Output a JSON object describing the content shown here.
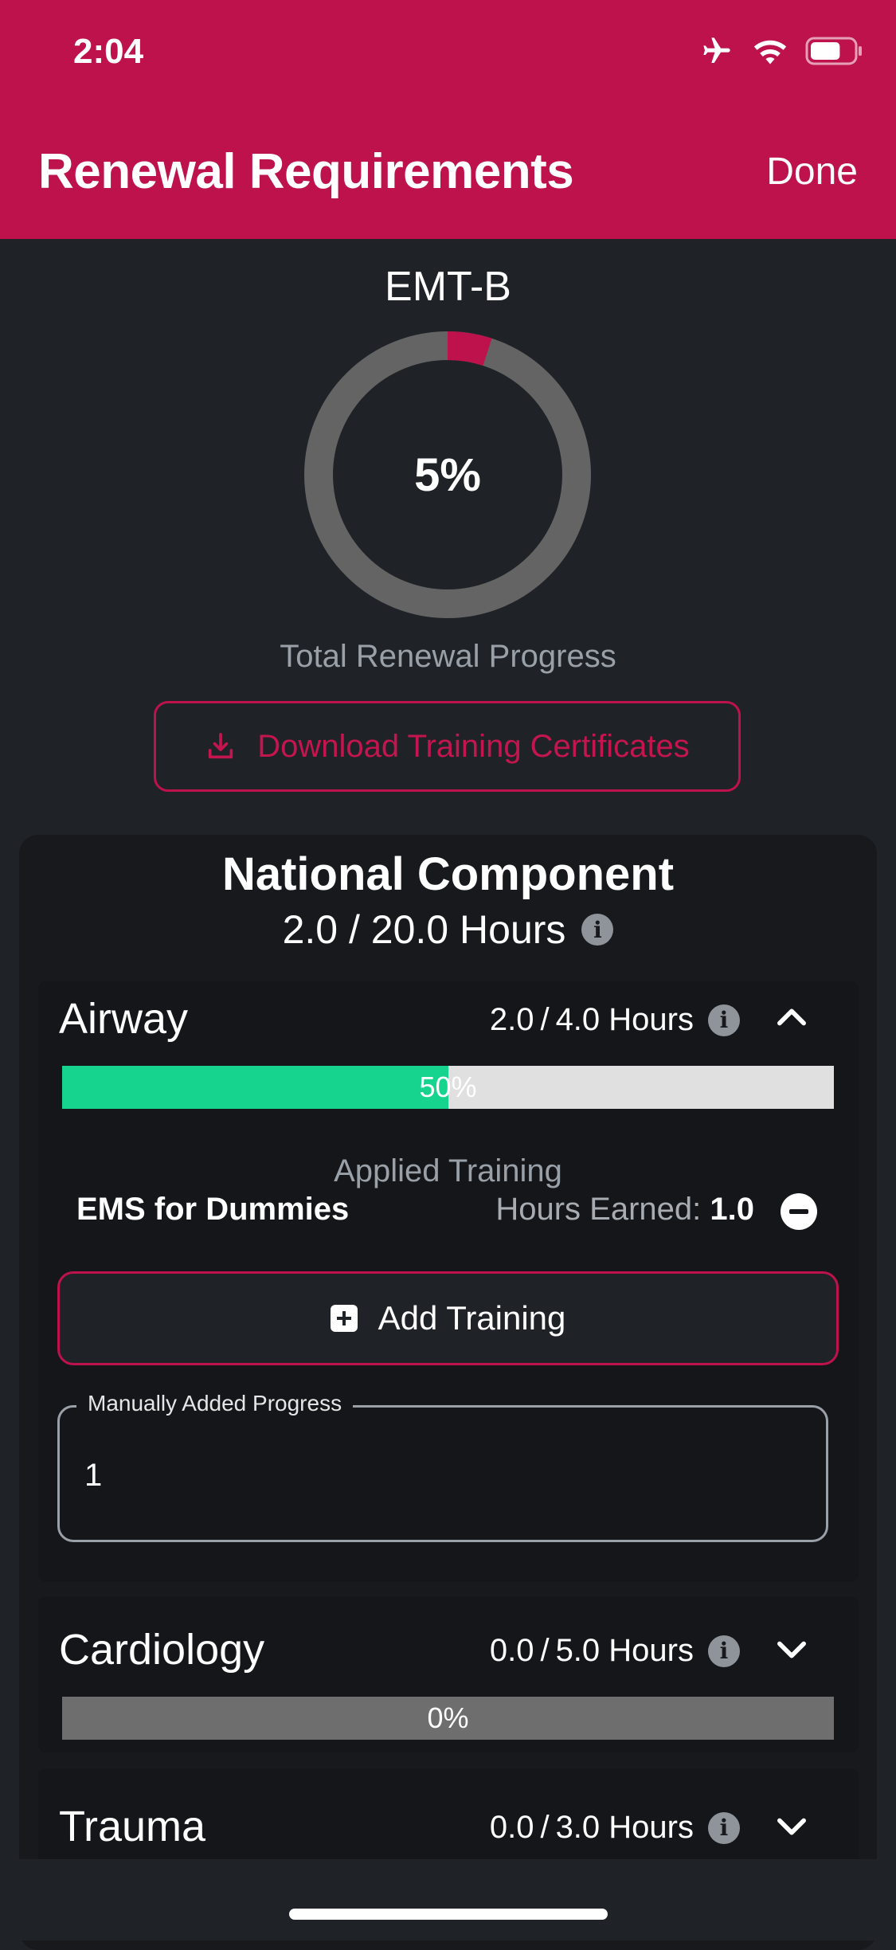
{
  "status_bar": {
    "time": "2:04",
    "battery_pct": 0.7
  },
  "nav": {
    "title": "Renewal Requirements",
    "done_label": "Done"
  },
  "summary": {
    "certification": "EMT-B",
    "progress_pct": "5%",
    "progress_value": 0.05,
    "progress_label": "Total Renewal Progress",
    "ring_color": "#bd124b",
    "ring_track_color": "#646464"
  },
  "download_button": {
    "label": "Download Training Certificates"
  },
  "national": {
    "title": "National Component",
    "earned": "2.0",
    "required": "20.0",
    "unit": "Hours"
  },
  "categories": [
    {
      "name": "Airway",
      "earned": "2.0",
      "required": "4.0",
      "unit": "Hours",
      "progress_value": 0.5,
      "progress_label": "50%",
      "fill_color": "#16d38e",
      "track_color": "#e0e0e0",
      "expanded": true
    },
    {
      "name": "Cardiology",
      "earned": "0.0",
      "required": "5.0",
      "unit": "Hours",
      "progress_value": 0.0,
      "progress_label": "0%",
      "fill_color": "#16d38e",
      "track_color": "#6e6e6e",
      "expanded": false
    },
    {
      "name": "Trauma",
      "earned": "0.0",
      "required": "3.0",
      "unit": "Hours",
      "expanded": false
    }
  ],
  "airway_detail": {
    "applied_label": "Applied Training",
    "trainings": [
      {
        "name": "EMS for Dummies",
        "earned_label": "Hours Earned:",
        "earned_value": "1.0"
      }
    ],
    "add_training_label": "Add Training",
    "manual_label": "Manually Added Progress",
    "manual_value": "1"
  }
}
